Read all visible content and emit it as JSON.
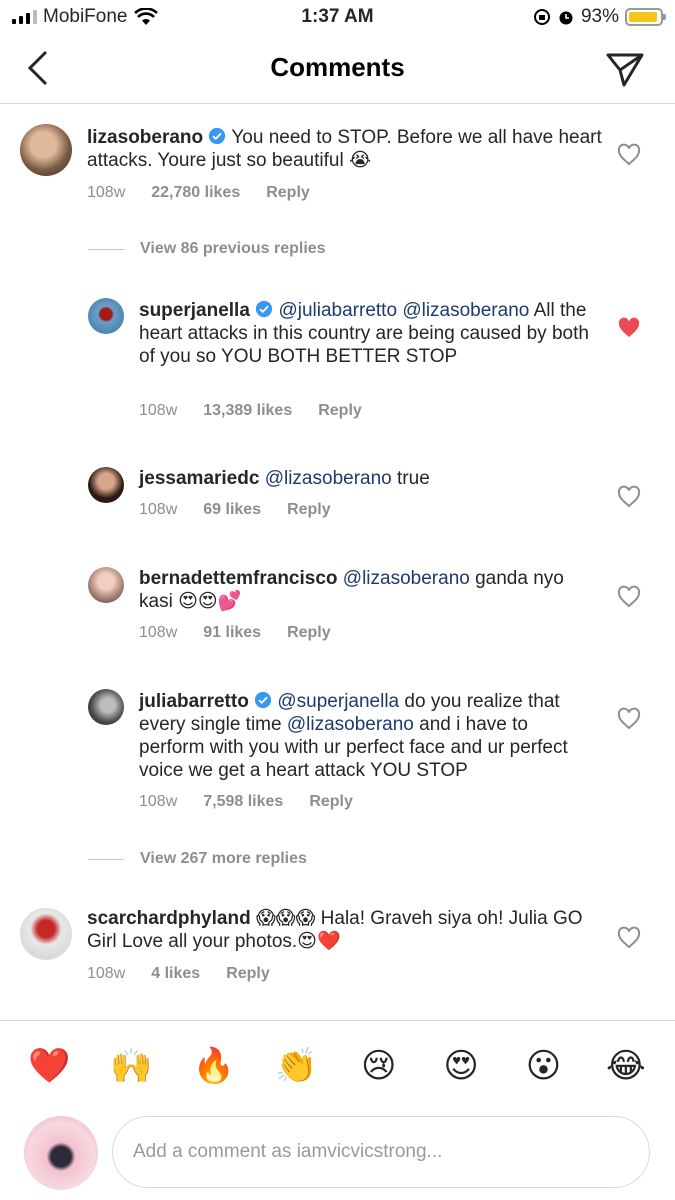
{
  "status_bar": {
    "carrier": "MobiFone",
    "time": "1:37 AM",
    "battery": "93%",
    "battery_level": 0.93
  },
  "header": {
    "title": "Comments"
  },
  "comments": [
    {
      "username": "lizasoberano",
      "verified": true,
      "text": "You need to STOP. Before we all have heart attacks. Youre just so beautiful 😭",
      "age": "108w",
      "likes": "22,780 likes",
      "reply": "Reply",
      "liked": false
    },
    {
      "view_replies": "View 86 previous replies"
    },
    {
      "username": "superjanella",
      "verified": true,
      "mentions": [
        "@juliabarretto",
        "@lizasoberano"
      ],
      "text": "All the heart attacks in this country are being caused by both of you so YOU BOTH BETTER STOP",
      "age": "108w",
      "likes": "13,389 likes",
      "reply": "Reply",
      "liked": true
    },
    {
      "username": "jessamariedc",
      "mentions": [
        "@lizasoberano"
      ],
      "text": "true",
      "age": "108w",
      "likes": "69 likes",
      "reply": "Reply",
      "liked": false
    },
    {
      "username": "bernadettemfrancisco",
      "mentions": [
        "@lizasoberano"
      ],
      "text": "ganda nyo kasi 😍😍💕",
      "age": "108w",
      "likes": "91 likes",
      "reply": "Reply",
      "liked": false
    },
    {
      "username": "juliabarretto",
      "verified": true,
      "mentions": [
        "@superjanella",
        "@lizasoberano"
      ],
      "text_a": "do you realize that every single time",
      "text_b": "and i have to perform with you with ur perfect face and ur perfect voice we get a heart attack YOU STOP",
      "age": "108w",
      "likes": "7,598 likes",
      "reply": "Reply",
      "liked": false
    },
    {
      "view_replies": "View 267 more replies"
    },
    {
      "username": "scarchardphyland",
      "text": "😱😱😱 Hala! Graveh  siya oh! Julia  GO Girl Love all your  photos.😍❤️",
      "age": "108w",
      "likes": "4 likes",
      "reply": "Reply",
      "liked": false
    }
  ],
  "reactions": [
    "❤️",
    "🙌",
    "🔥",
    "👏",
    "😢",
    "😍",
    "😮",
    "😂"
  ],
  "composer": {
    "placeholder": "Add a comment as iamvicvicstrong..."
  },
  "colors": {
    "liked_heart": "#ed4956",
    "verified": "#3897f0",
    "mention": "#1e3a6e",
    "battery": "#f5c518"
  }
}
